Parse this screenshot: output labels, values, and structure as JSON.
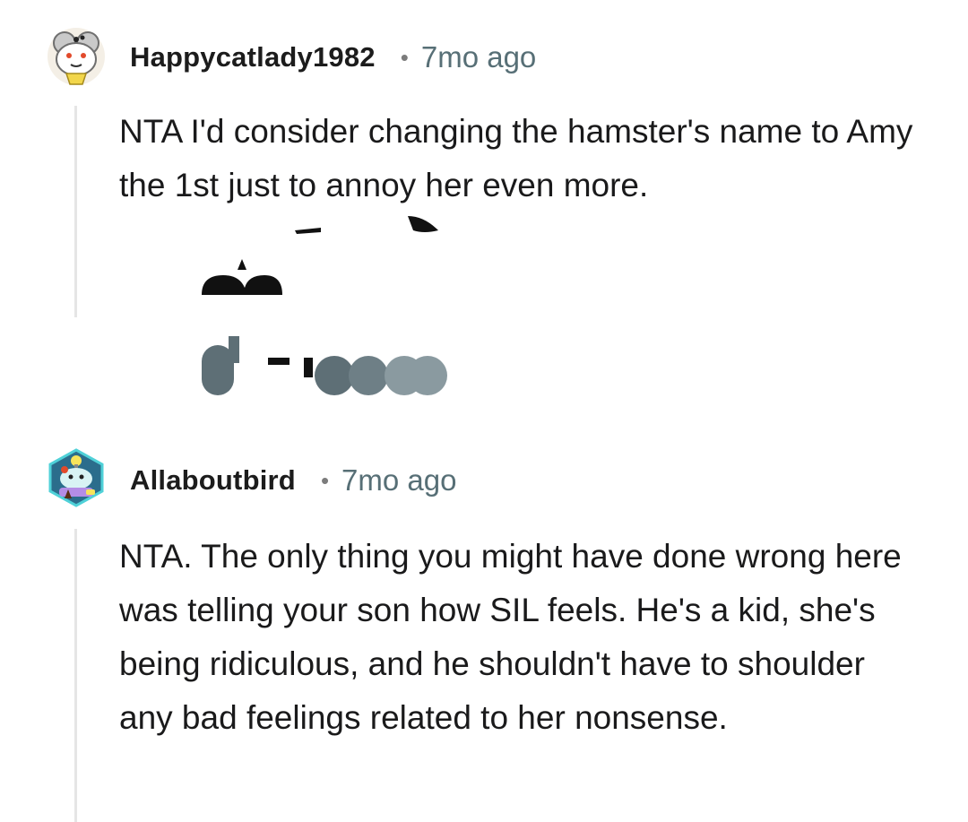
{
  "comments": [
    {
      "username": "Happycatlady1982",
      "separator": "•",
      "time": "7mo ago",
      "text": "NTA I'd consider changing the hamster's name to Amy the 1st just to annoy her even more.",
      "avatar_icon": "snoo-avatar-icon"
    },
    {
      "username": "Allaboutbird",
      "separator": "•",
      "time": "7mo ago",
      "text": "NTA. The only thing you might have done wrong here was telling your son how SIL feels. He's a kid, she's being ridiculous, and he shouldn't have to shoulder any bad feelings related to her nonsense.",
      "avatar_icon": "snoo-avatar-icon"
    }
  ],
  "colors": {
    "username": "#1c1c1c",
    "time": "#576f76",
    "thread_line": "#e5e5e5",
    "text": "#1a1a1b"
  }
}
